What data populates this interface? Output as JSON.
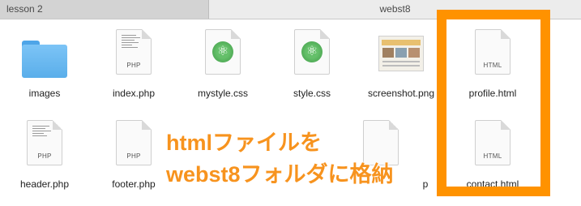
{
  "tabs": [
    {
      "label": "lesson 2",
      "active": false
    },
    {
      "label": "webst8",
      "active": true
    }
  ],
  "files_row1": [
    {
      "name": "images",
      "kind": "folder"
    },
    {
      "name": "index.php",
      "kind": "doc",
      "ext": "PHP"
    },
    {
      "name": "mystyle.css",
      "kind": "atom-doc"
    },
    {
      "name": "style.css",
      "kind": "atom-doc"
    },
    {
      "name": "screenshot.png",
      "kind": "thumbnail"
    },
    {
      "name": "profile.html",
      "kind": "doc",
      "ext": "HTML"
    }
  ],
  "files_row2": [
    {
      "name": "header.php",
      "kind": "doc",
      "ext": "PHP"
    },
    {
      "name": "footer.php",
      "kind": "doc",
      "ext": "PHP"
    },
    {
      "name": "p",
      "kind": "partial"
    },
    {
      "name": "contact.html",
      "kind": "doc",
      "ext": "HTML"
    }
  ],
  "annotation": {
    "line1": "htmlファイルを",
    "line2": "webst8フォルダに格納"
  },
  "colors": {
    "highlight": "#ff9200",
    "annotation_text": "#f7931e",
    "folder": "#6bbaf2",
    "atom": "#4fae55"
  },
  "icons": {
    "folder": "folder-icon",
    "document": "document-icon",
    "atom": "atom-icon",
    "image": "image-thumbnail-icon"
  }
}
